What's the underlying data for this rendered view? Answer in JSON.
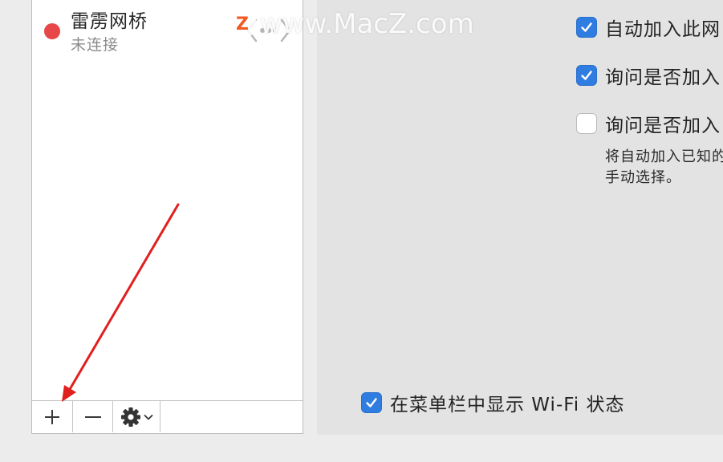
{
  "service_list": {
    "items": [
      {
        "name": "雷雳网桥",
        "status": "未连接",
        "status_color": "#e8474a"
      }
    ]
  },
  "action_bar": {
    "add_symbol": "+",
    "remove_symbol": "−",
    "gear_icon": "gear-icon"
  },
  "wifi_options": [
    {
      "label": "自动加入此网",
      "checked": true
    },
    {
      "label": "询问是否加入",
      "checked": true
    },
    {
      "label": "询问是否加入",
      "checked": false
    }
  ],
  "wifi_option_description": {
    "line1": "将自动加入已知的",
    "line2": "手动选择。"
  },
  "menu_bar_option": {
    "label": "在菜单栏中显示 Wi-Fi 状态",
    "checked": true
  },
  "watermark": {
    "badge": "Z",
    "text": "www.MacZ.com"
  },
  "colors": {
    "accent": "#2f7de1",
    "annotation": "#e0201f",
    "status_disconnected": "#e8474a"
  }
}
